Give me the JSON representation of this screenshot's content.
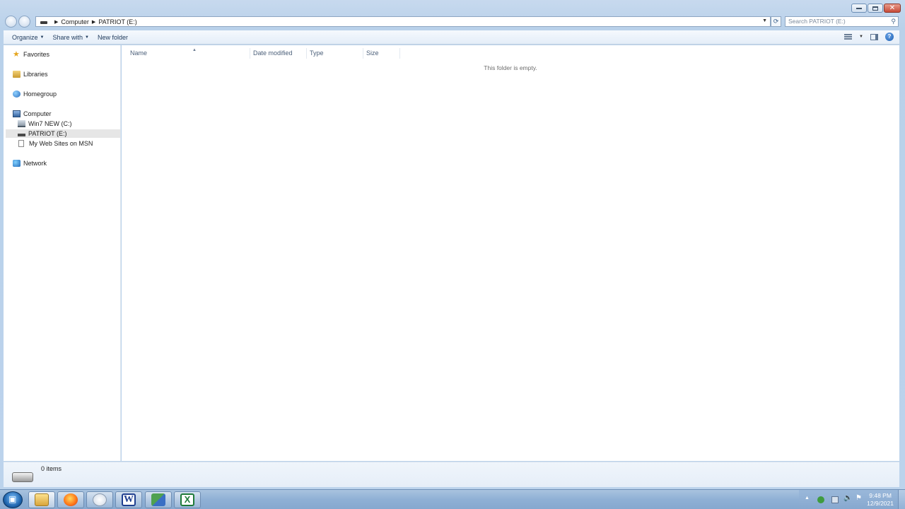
{
  "address": {
    "crumbs": [
      "Computer",
      "PATRIOT (E:)"
    ],
    "search_placeholder": "Search PATRIOT (E:)"
  },
  "toolbar": {
    "organize": "Organize",
    "share_with": "Share with",
    "new_folder": "New folder"
  },
  "nav": {
    "favorites": "Favorites",
    "libraries": "Libraries",
    "homegroup": "Homegroup",
    "computer": "Computer",
    "computer_children": [
      "Win7 NEW (C:)",
      "PATRIOT (E:)",
      "My Web Sites on MSN"
    ],
    "network": "Network",
    "selected": "PATRIOT (E:)"
  },
  "columns": [
    "Name",
    "Date modified",
    "Type",
    "Size"
  ],
  "content": {
    "empty_message": "This folder is empty."
  },
  "details": {
    "item_count": "0 items"
  },
  "taskbar": {
    "apps": [
      "explorer-icon",
      "firefox-icon",
      "paint-icon",
      "word-icon",
      "app-icon",
      "excel-icon"
    ],
    "word_glyph": "W",
    "excel_glyph": "X",
    "time": "9:48 PM",
    "date": "12/9/2021"
  },
  "colors": {
    "frame": "#b9d1ea",
    "taskbar": "#8fb0d5",
    "selection": "#e6e6e6"
  }
}
